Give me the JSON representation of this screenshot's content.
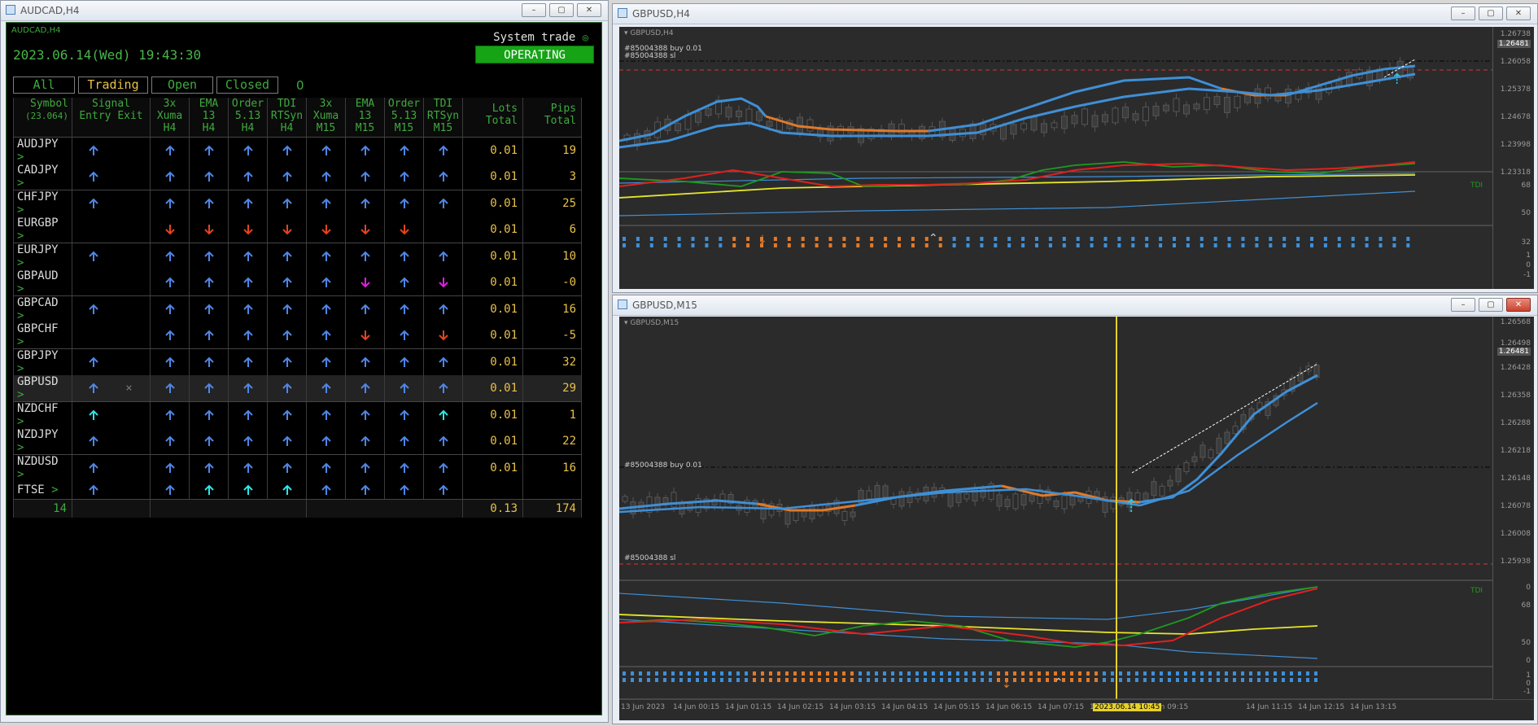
{
  "colors": {
    "up": "#4f86e6",
    "down": "#e8421f",
    "cyan": "#2ee6e6",
    "magenta": "#e020e0",
    "trade_green": "#16a316",
    "table_green": "#3fa93f",
    "gold": "#e8c14a"
  },
  "dashboard": {
    "window_title": "AUDCAD,H4",
    "corner_label": "AUDCAD,H4",
    "datetime": "2023.06.14(Wed) 19:43:30",
    "system_label": "System trade",
    "status": "OPERATING",
    "filters": {
      "all": "All",
      "trading": "Trading",
      "open": "Open",
      "closed": "Closed",
      "count": "0"
    },
    "headers": {
      "symbol": "Symbol",
      "equity": "(23.064)",
      "signal": "Signal",
      "entry": "Entry",
      "exit": "Exit",
      "c1": [
        "3x",
        "Xuma",
        "H4"
      ],
      "c2": [
        "EMA",
        "13",
        "H4"
      ],
      "c3": [
        "Order",
        "5.13",
        "H4"
      ],
      "c4": [
        "TDI",
        "RTSyn",
        "H4"
      ],
      "c5": [
        "3x",
        "Xuma",
        "M15"
      ],
      "c6": [
        "EMA",
        "13",
        "M15"
      ],
      "c7": [
        "Order",
        "5.13",
        "M15"
      ],
      "c8": [
        "TDI",
        "RTSyn",
        "M15"
      ],
      "lots": [
        "Lots",
        "Total"
      ],
      "pips": [
        "Pips",
        "Total"
      ]
    },
    "rows": [
      {
        "symbol": "AUDJPY",
        "entry": "up",
        "exit": "",
        "i": [
          "up",
          "up",
          "up",
          "up",
          "up",
          "up",
          "up",
          "up"
        ],
        "lots": "0.01",
        "pips": "19"
      },
      {
        "symbol": "CADJPY",
        "entry": "up",
        "exit": "",
        "i": [
          "up",
          "up",
          "up",
          "up",
          "up",
          "up",
          "up",
          "up"
        ],
        "lots": "0.01",
        "pips": "3"
      },
      {
        "symbol": "CHFJPY",
        "entry": "up",
        "exit": "",
        "i": [
          "up",
          "up",
          "up",
          "up",
          "up",
          "up",
          "up",
          "up"
        ],
        "lots": "0.01",
        "pips": "25"
      },
      {
        "symbol": "EURGBP",
        "entry": "",
        "exit": "",
        "i": [
          "down",
          "down",
          "down",
          "down",
          "down",
          "down",
          "down",
          ""
        ],
        "lots": "0.01",
        "pips": "6"
      },
      {
        "symbol": "EURJPY",
        "entry": "up",
        "exit": "",
        "i": [
          "up",
          "up",
          "up",
          "up",
          "up",
          "up",
          "up",
          "up"
        ],
        "lots": "0.01",
        "pips": "10"
      },
      {
        "symbol": "GBPAUD",
        "entry": "",
        "exit": "",
        "i": [
          "up",
          "up",
          "up",
          "up",
          "up",
          "mdown",
          "up",
          "mdown"
        ],
        "lots": "0.01",
        "pips": "-0"
      },
      {
        "symbol": "GBPCAD",
        "entry": "up",
        "exit": "",
        "i": [
          "up",
          "up",
          "up",
          "up",
          "up",
          "up",
          "up",
          "up"
        ],
        "lots": "0.01",
        "pips": "16"
      },
      {
        "symbol": "GBPCHF",
        "entry": "",
        "exit": "",
        "i": [
          "up",
          "up",
          "up",
          "up",
          "up",
          "down",
          "up",
          "down"
        ],
        "lots": "0.01",
        "pips": "-5"
      },
      {
        "symbol": "GBPJPY",
        "entry": "up",
        "exit": "",
        "i": [
          "up",
          "up",
          "up",
          "up",
          "up",
          "up",
          "up",
          "up"
        ],
        "lots": "0.01",
        "pips": "32"
      },
      {
        "symbol": "GBPUSD",
        "entry": "up",
        "exit": "×",
        "i": [
          "up",
          "up",
          "up",
          "up",
          "up",
          "up",
          "up",
          "up"
        ],
        "lots": "0.01",
        "pips": "29"
      },
      {
        "symbol": "NZDCHF",
        "entry": "cyan",
        "exit": "",
        "i": [
          "up",
          "up",
          "up",
          "up",
          "up",
          "up",
          "up",
          "cyan"
        ],
        "lots": "0.01",
        "pips": "1"
      },
      {
        "symbol": "NZDJPY",
        "entry": "up",
        "exit": "",
        "i": [
          "up",
          "up",
          "up",
          "up",
          "up",
          "up",
          "up",
          "up"
        ],
        "lots": "0.01",
        "pips": "22"
      },
      {
        "symbol": "NZDUSD",
        "entry": "up",
        "exit": "",
        "i": [
          "up",
          "up",
          "up",
          "up",
          "up",
          "up",
          "up",
          "up"
        ],
        "lots": "0.01",
        "pips": "16"
      },
      {
        "symbol": "FTSE",
        "entry": "up",
        "exit": "",
        "i": [
          "up",
          "cyan",
          "cyan",
          "cyan",
          "up",
          "up",
          "up",
          "up"
        ],
        "lots": "",
        "pips": ""
      }
    ],
    "footer": {
      "count": "14",
      "lots": "0.13",
      "pips": "174"
    }
  },
  "h4": {
    "window_title": "GBPUSD,H4",
    "inner_label": "GBPUSD,H4",
    "order_buy": "#85004388 buy 0.01",
    "order_sl": "#85004388 sl",
    "prices": [
      "1.26738",
      "1.26481",
      "1.26058",
      "1.25378",
      "1.24678",
      "1.23998",
      "1.23318"
    ],
    "tdi_label": "TDI",
    "tdi_levels": [
      "68",
      "50",
      "32"
    ],
    "sig_levels": [
      "1",
      "0",
      "-1"
    ]
  },
  "m15": {
    "window_title": "GBPUSD,M15",
    "inner_label": "GBPUSD,M15",
    "order_buy": "#85004388 buy 0.01",
    "order_sl": "#85004388 sl",
    "prices": [
      "1.26568",
      "1.26498",
      "1.26481",
      "1.26428",
      "1.26358",
      "1.26288",
      "1.26218",
      "1.26148",
      "1.26078",
      "1.26008",
      "1.25938"
    ],
    "tdi_label": "TDI",
    "tdi_levels": [
      "0",
      "68",
      "50",
      "0"
    ],
    "sig_levels": [
      "1",
      "0",
      "-1"
    ],
    "xticks": [
      "13 Jun 2023",
      "14 Jun 00:15",
      "14 Jun 01:15",
      "14 Jun 02:15",
      "14 Jun 03:15",
      "14 Jun 04:15",
      "14 Jun 05:15",
      "14 Jun 06:15",
      "14 Jun 07:15",
      "14 Jun 08:15",
      "14 Jun 09:15",
      "2023.06.14 10:45",
      "14 Jun 11:15",
      "14 Jun 12:15",
      "14 Jun 13:15"
    ]
  }
}
